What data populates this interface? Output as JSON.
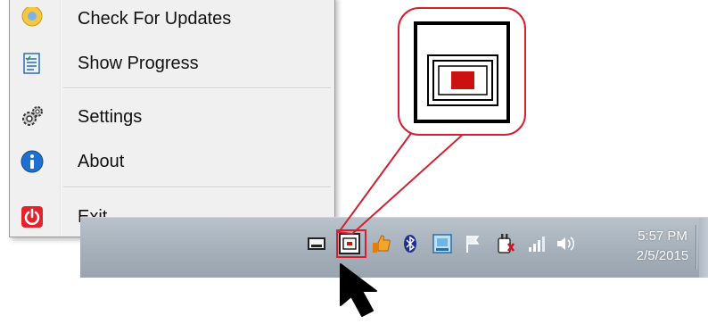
{
  "context_menu": {
    "items": [
      {
        "label": "Check For Updates",
        "icon": "update-icon"
      },
      {
        "label": "Show Progress",
        "icon": "progress-icon"
      },
      {
        "label": "Settings",
        "icon": "gears-icon"
      },
      {
        "label": "About",
        "icon": "info-icon"
      },
      {
        "label": "Exit",
        "icon": "power-icon"
      }
    ]
  },
  "tray": {
    "icons": [
      "keyboard-icon",
      "device-app-icon",
      "thumbs-up-icon",
      "bluetooth-icon",
      "network-app-icon",
      "flag-icon",
      "power-plug-icon",
      "signal-icon",
      "volume-icon"
    ],
    "clock": {
      "time": "5:57 PM",
      "date": "2/5/2015"
    }
  },
  "colors": {
    "callout_red": "#d42030",
    "indicator_red": "#cc1111",
    "taskbar": "#a6b0ba"
  }
}
